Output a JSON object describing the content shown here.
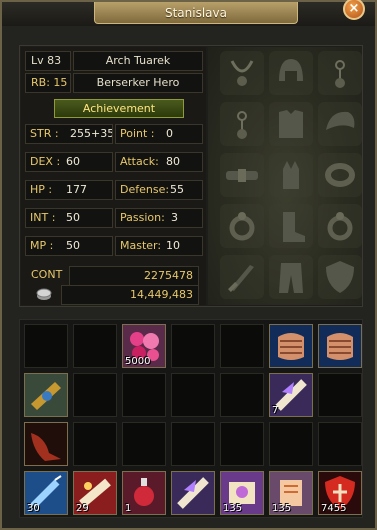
{
  "window": {
    "title": "Stanislava",
    "close_glyph": "×"
  },
  "character": {
    "level": "Lv 83",
    "name": "Arch Tuarek",
    "rebirth": "RB: 15",
    "class_name": "Berserker Hero",
    "achievement_label": "Achievement"
  },
  "stats": [
    {
      "key": "str",
      "label": "STR :",
      "value": "255+35"
    },
    {
      "key": "point",
      "label": "Point :",
      "value": "0"
    },
    {
      "key": "dex",
      "label": "DEX :",
      "value": "60"
    },
    {
      "key": "attack",
      "label": "Attack:",
      "value": "80"
    },
    {
      "key": "hp",
      "label": "HP :",
      "value": "177"
    },
    {
      "key": "defense",
      "label": "Defense:",
      "value": "55"
    },
    {
      "key": "int",
      "label": "INT :",
      "value": "50"
    },
    {
      "key": "passion",
      "label": "Passion:",
      "value": "3"
    },
    {
      "key": "mp",
      "label": "MP :",
      "value": "50"
    },
    {
      "key": "master",
      "label": "Master:",
      "value": "10"
    }
  ],
  "cont": {
    "label": "CONT",
    "value": "2275478"
  },
  "money": {
    "icon": "coin-icon",
    "value": "14,449,483"
  },
  "equipment_slots": [
    "necklace-icon",
    "helmet-icon",
    "earring-icon",
    "earring-icon",
    "armor-icon",
    "shoulder-icon",
    "belt-icon",
    "gloves-icon",
    "bracelet-icon",
    "ring-icon",
    "boots-icon",
    "ring-icon",
    "weapon-icon",
    "pants-icon",
    "shield-icon"
  ],
  "inventory": [
    {
      "slot": 2,
      "icon": "pink-potion-bag-icon",
      "qty": "5000"
    },
    {
      "slot": 5,
      "icon": "armor-piece-icon",
      "qty": ""
    },
    {
      "slot": 6,
      "icon": "armor-piece-icon",
      "qty": ""
    },
    {
      "slot": 7,
      "icon": "golden-armband-icon",
      "qty": ""
    },
    {
      "slot": 12,
      "icon": "purple-scroll-icon",
      "qty": "7"
    },
    {
      "slot": 14,
      "icon": "red-cape-icon",
      "qty": ""
    },
    {
      "slot": 21,
      "icon": "blue-syringe-icon",
      "qty": "30"
    },
    {
      "slot": 22,
      "icon": "red-scroll-icon",
      "qty": "29"
    },
    {
      "slot": 23,
      "icon": "red-bottle-icon",
      "qty": "1"
    },
    {
      "slot": 24,
      "icon": "purple-scroll-icon",
      "qty": ""
    },
    {
      "slot": 25,
      "icon": "transform-scroll-icon",
      "qty": "135"
    },
    {
      "slot": 26,
      "icon": "orange-scroll-icon",
      "qty": "135"
    },
    {
      "slot": 27,
      "icon": "red-shield-potion-icon",
      "qty": "7455"
    }
  ],
  "colors": {
    "stat_label": "#e8c86a",
    "achievement_text": "#ffe680",
    "title_plate": "#b8a06a"
  }
}
